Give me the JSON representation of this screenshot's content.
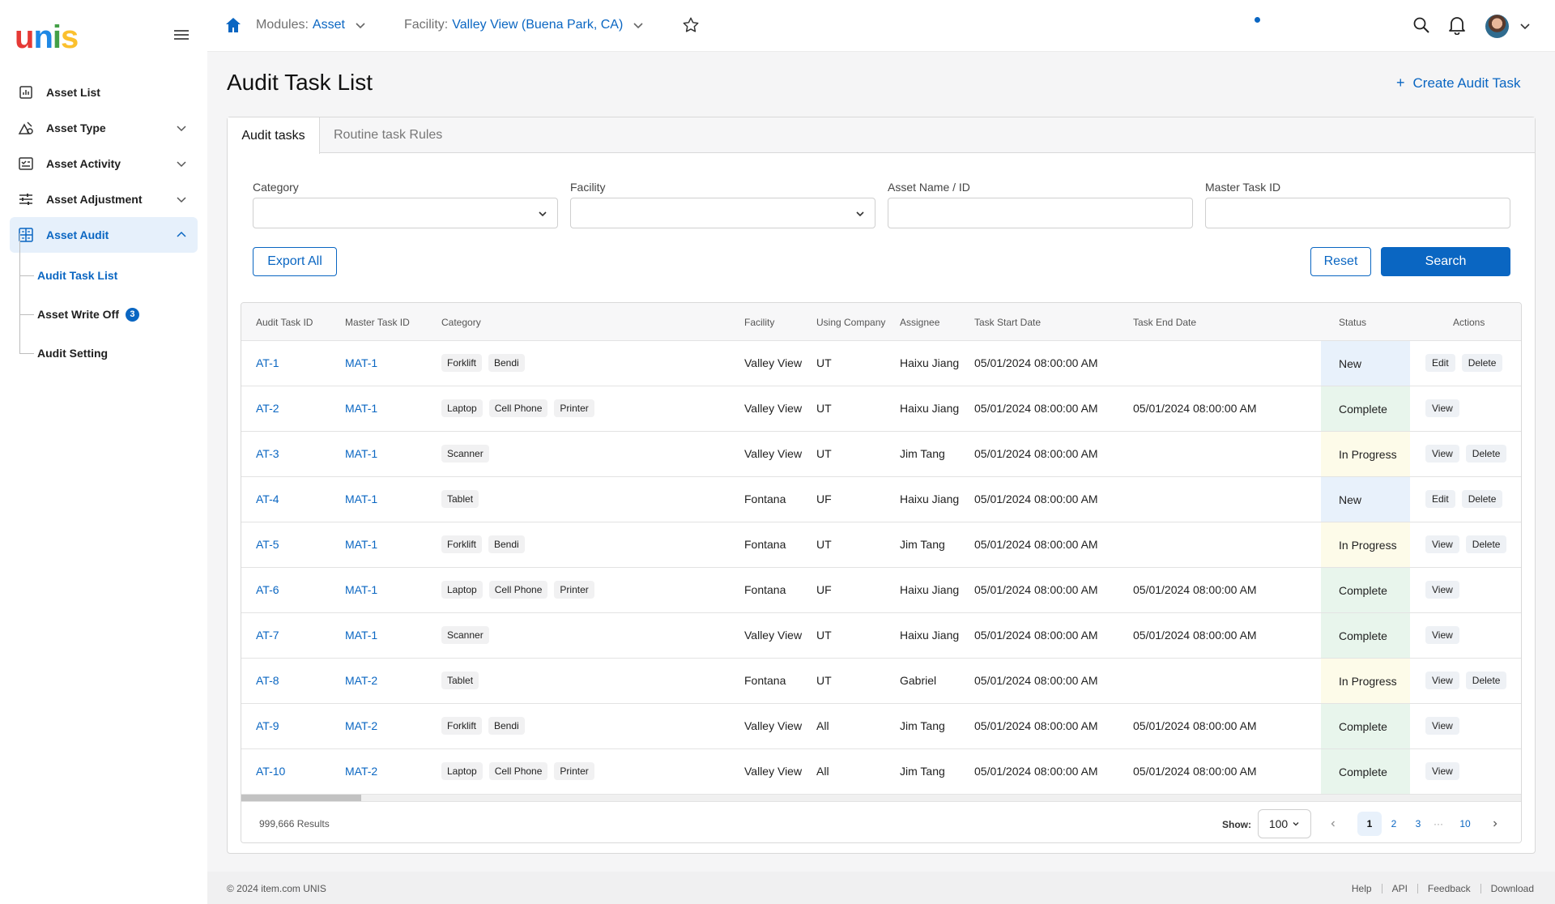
{
  "brand": {
    "logo_u": "u",
    "logo_n": "n",
    "logo_i": "i",
    "logo_s": "s"
  },
  "sidebar": {
    "items": [
      {
        "label": "Asset List",
        "icon": "chart-icon"
      },
      {
        "label": "Asset Type",
        "icon": "shapes-icon"
      },
      {
        "label": "Asset Activity",
        "icon": "activity-icon"
      },
      {
        "label": "Asset Adjustment",
        "icon": "sliders-icon"
      },
      {
        "label": "Asset Audit",
        "icon": "grid-icon"
      }
    ],
    "sub_items": [
      {
        "label": "Audit Task List"
      },
      {
        "label": "Asset Write Off",
        "badge": "3"
      },
      {
        "label": "Audit Setting"
      }
    ]
  },
  "header": {
    "module_label": "Modules:",
    "module_value": "Asset",
    "facility_label": "Facility:",
    "facility_value": "Valley View (Buena Park, CA)"
  },
  "page": {
    "title": "Audit Task List",
    "create_label": "Create Audit Task"
  },
  "tabs": [
    {
      "label": "Audit tasks"
    },
    {
      "label": "Routine task Rules"
    }
  ],
  "filters": {
    "category_label": "Category",
    "facility_label": "Facility",
    "asset_label": "Asset Name / ID",
    "master_label": "Master Task ID"
  },
  "buttons": {
    "export": "Export All",
    "reset": "Reset",
    "search": "Search"
  },
  "table": {
    "columns": [
      "Audit Task ID",
      "Master Task ID",
      "Category",
      "Facility",
      "Using Company",
      "Assignee",
      "Task Start Date",
      "Task End Date",
      "Status",
      "Actions"
    ],
    "rows": [
      {
        "id": "AT-1",
        "master": "MAT-1",
        "tags": [
          "Forklift",
          "Bendi"
        ],
        "facility": "Valley View",
        "company": "UT",
        "assignee": "Haixu Jiang",
        "start": "05/01/2024 08:00:00 AM",
        "end": "",
        "status": "New",
        "actions": [
          "Edit",
          "Delete"
        ]
      },
      {
        "id": "AT-2",
        "master": "MAT-1",
        "tags": [
          "Laptop",
          "Cell Phone",
          "Printer"
        ],
        "facility": "Valley View",
        "company": "UT",
        "assignee": "Haixu Jiang",
        "start": "05/01/2024 08:00:00 AM",
        "end": "05/01/2024 08:00:00 AM",
        "status": "Complete",
        "actions": [
          "View"
        ]
      },
      {
        "id": "AT-3",
        "master": "MAT-1",
        "tags": [
          "Scanner"
        ],
        "facility": "Valley View",
        "company": "UT",
        "assignee": "Jim Tang",
        "start": "05/01/2024 08:00:00 AM",
        "end": "",
        "status": "In Progress",
        "actions": [
          "View",
          "Delete"
        ]
      },
      {
        "id": "AT-4",
        "master": "MAT-1",
        "tags": [
          "Tablet"
        ],
        "facility": "Fontana",
        "company": "UF",
        "assignee": "Haixu Jiang",
        "start": "05/01/2024 08:00:00 AM",
        "end": "",
        "status": "New",
        "actions": [
          "Edit",
          "Delete"
        ]
      },
      {
        "id": "AT-5",
        "master": "MAT-1",
        "tags": [
          "Forklift",
          "Bendi"
        ],
        "facility": "Fontana",
        "company": "UT",
        "assignee": "Jim Tang",
        "start": "05/01/2024 08:00:00 AM",
        "end": "",
        "status": "In Progress",
        "actions": [
          "View",
          "Delete"
        ]
      },
      {
        "id": "AT-6",
        "master": "MAT-1",
        "tags": [
          "Laptop",
          "Cell Phone",
          "Printer"
        ],
        "facility": "Fontana",
        "company": "UF",
        "assignee": "Haixu Jiang",
        "start": "05/01/2024 08:00:00 AM",
        "end": "05/01/2024 08:00:00 AM",
        "status": "Complete",
        "actions": [
          "View"
        ]
      },
      {
        "id": "AT-7",
        "master": "MAT-1",
        "tags": [
          "Scanner"
        ],
        "facility": "Valley View",
        "company": "UT",
        "assignee": "Haixu Jiang",
        "start": "05/01/2024 08:00:00 AM",
        "end": "05/01/2024 08:00:00 AM",
        "status": "Complete",
        "actions": [
          "View"
        ]
      },
      {
        "id": "AT-8",
        "master": "MAT-2",
        "tags": [
          "Tablet"
        ],
        "facility": "Fontana",
        "company": "UT",
        "assignee": "Gabriel",
        "start": "05/01/2024 08:00:00 AM",
        "end": "",
        "status": "In Progress",
        "actions": [
          "View",
          "Delete"
        ]
      },
      {
        "id": "AT-9",
        "master": "MAT-2",
        "tags": [
          "Forklift",
          "Bendi"
        ],
        "facility": "Valley View",
        "company": "All",
        "assignee": "Jim Tang",
        "start": "05/01/2024 08:00:00 AM",
        "end": "05/01/2024 08:00:00 AM",
        "status": "Complete",
        "actions": [
          "View"
        ]
      },
      {
        "id": "AT-10",
        "master": "MAT-2",
        "tags": [
          "Laptop",
          "Cell Phone",
          "Printer"
        ],
        "facility": "Valley View",
        "company": "All",
        "assignee": "Jim Tang",
        "start": "05/01/2024 08:00:00 AM",
        "end": "05/01/2024 08:00:00 AM",
        "status": "Complete",
        "actions": [
          "View"
        ]
      }
    ]
  },
  "pagination": {
    "results": "999,666 Results",
    "show_label": "Show:",
    "page_size": "100",
    "pages": [
      "1",
      "2",
      "3",
      "10"
    ],
    "ellipsis": "···",
    "current": "1"
  },
  "footer": {
    "copyright": "© 2024 item.com UNIS",
    "links": [
      "Help",
      "API",
      "Feedback",
      "Download"
    ]
  },
  "colors": {
    "accent": "#0a66c2",
    "status_new": "#e8f1fb",
    "status_complete": "#e8f5ec",
    "status_progress": "#fdfbe9"
  }
}
